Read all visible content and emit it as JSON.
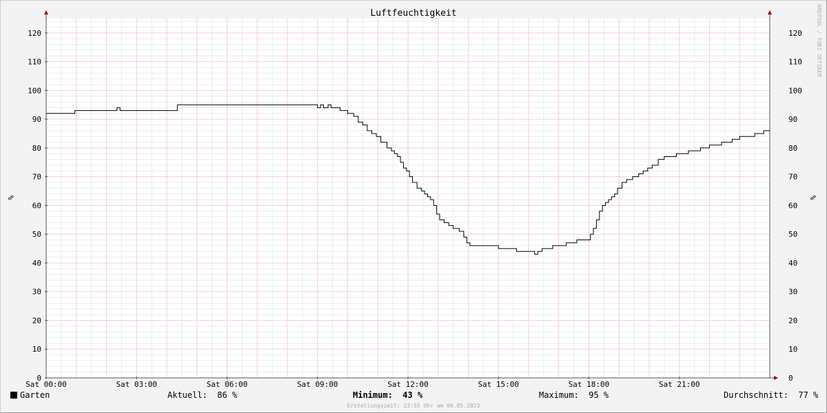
{
  "chart_data": {
    "type": "line",
    "title": "Luftfeuchtigkeit",
    "ylabel": "%",
    "ylabel_right": "%",
    "watermark": "RRDTOOL / TOBI OETIKER",
    "ylim": [
      0,
      125
    ],
    "yticks": [
      0,
      10,
      20,
      30,
      40,
      50,
      60,
      70,
      80,
      90,
      100,
      110,
      120
    ],
    "xlim": [
      0,
      24
    ],
    "xticks": [
      {
        "x": 0,
        "label": "Sat 00:00"
      },
      {
        "x": 3,
        "label": "Sat 03:00"
      },
      {
        "x": 6,
        "label": "Sat 06:00"
      },
      {
        "x": 9,
        "label": "Sat 09:00"
      },
      {
        "x": 12,
        "label": "Sat 12:00"
      },
      {
        "x": 15,
        "label": "Sat 15:00"
      },
      {
        "x": 18,
        "label": "Sat 18:00"
      },
      {
        "x": 21,
        "label": "Sat 21:00"
      }
    ],
    "grid": true,
    "series": [
      {
        "name": "Garten",
        "color": "#000000",
        "x": [
          0,
          0.95,
          2.35,
          2.45,
          4.35,
          9.0,
          9.1,
          9.2,
          9.35,
          9.45,
          9.75,
          10.0,
          10.2,
          10.35,
          10.5,
          10.65,
          10.8,
          10.95,
          11.1,
          11.3,
          11.45,
          11.55,
          11.65,
          11.75,
          11.85,
          11.95,
          12.05,
          12.15,
          12.3,
          12.45,
          12.55,
          12.65,
          12.75,
          12.85,
          12.95,
          13.05,
          13.2,
          13.35,
          13.5,
          13.7,
          13.85,
          13.95,
          14.05,
          14.3,
          15.0,
          15.6,
          16.2,
          16.3,
          16.45,
          16.8,
          17.25,
          17.6,
          18.05,
          18.15,
          18.25,
          18.35,
          18.45,
          18.55,
          18.65,
          18.75,
          18.85,
          18.95,
          19.1,
          19.25,
          19.45,
          19.65,
          19.8,
          19.95,
          20.1,
          20.3,
          20.5,
          20.9,
          21.3,
          21.7,
          22.0,
          22.4,
          22.75,
          23.0,
          23.5,
          23.8,
          24.0
        ],
        "values": [
          92,
          93,
          94,
          93,
          95,
          94,
          95,
          94,
          95,
          94,
          93,
          92,
          91,
          89,
          88,
          86,
          85,
          84,
          82,
          80,
          79,
          78,
          77,
          75,
          73,
          72,
          70,
          68,
          66,
          65,
          64,
          63,
          62,
          60,
          57,
          55,
          54,
          53,
          52,
          51,
          49,
          47,
          46,
          46,
          45,
          44,
          43,
          44,
          45,
          46,
          47,
          48,
          50,
          52,
          55,
          58,
          60,
          61,
          62,
          63,
          64,
          66,
          68,
          69,
          70,
          71,
          72,
          73,
          74,
          76,
          77,
          78,
          79,
          80,
          81,
          82,
          83,
          84,
          85,
          86,
          86
        ]
      }
    ]
  },
  "legend": {
    "series_name": "Garten",
    "current_label": "Aktuell:",
    "current_value": "86 %",
    "min_label": "Minimum:",
    "min_value": "43 %",
    "max_label": "Maximum:",
    "max_value": "95 %",
    "avg_label": "Durchschnitt:",
    "avg_value": "77 %"
  },
  "footer": "Erstellungszeit: 23:55 Uhr am 06.05.2023"
}
